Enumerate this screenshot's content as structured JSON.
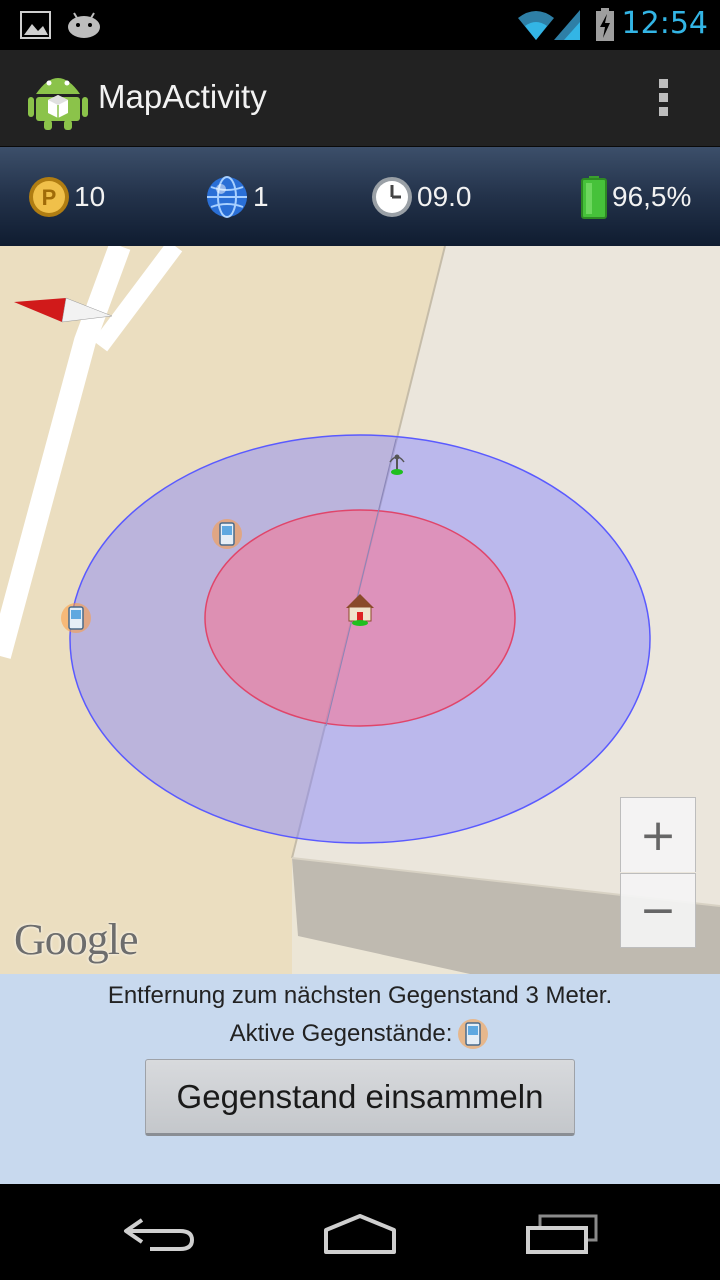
{
  "status_bar": {
    "time": "12:54",
    "icons": [
      "gallery-notification-icon",
      "android-notification-icon",
      "wifi-icon",
      "signal-icon",
      "battery-charging-icon"
    ]
  },
  "action_bar": {
    "title": "MapActivity",
    "app_icon": "android-robot-icon",
    "overflow_icon": "overflow-menu-icon"
  },
  "stats": {
    "points": "10",
    "globe": "1",
    "clock": "09.0",
    "battery": "96,5%",
    "colors": {
      "coin": "#d9a520",
      "globe": "#2a6fd6",
      "battery": "#46c23a"
    }
  },
  "map": {
    "google_logo": "Google",
    "zoom_in_label": "+",
    "zoom_out_label": "−",
    "colors": {
      "outer_circle": "#8080ff",
      "inner_circle": "#ff6b8a",
      "land": "#ebdec0",
      "road": "#ffffff"
    }
  },
  "panel": {
    "distance_text": "Entfernung zum nächsten Gegenstand 3 Meter.",
    "active_items_label": "Aktive Gegenstände:",
    "collect_button": "Gegenstand einsammeln"
  },
  "nav_bar": {
    "icons": [
      "back-icon",
      "home-icon",
      "recent-apps-icon"
    ]
  }
}
